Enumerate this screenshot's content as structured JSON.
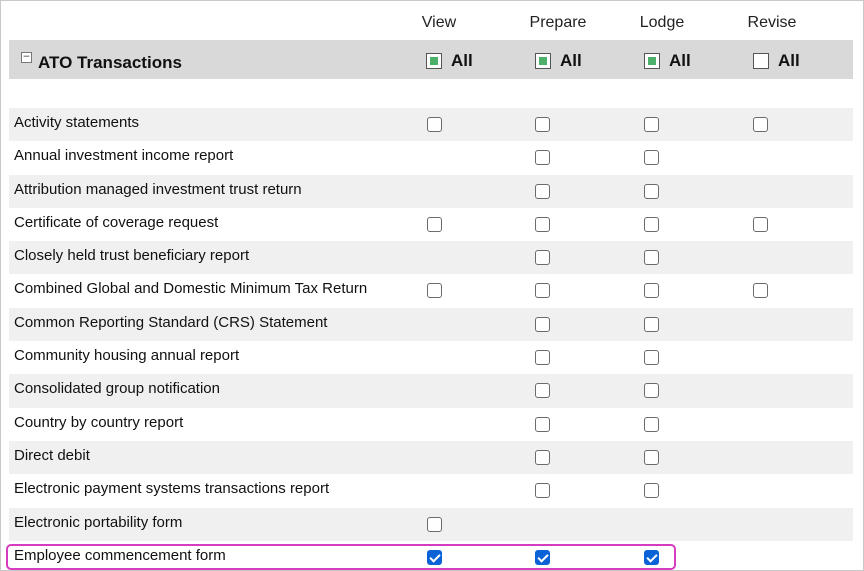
{
  "columns": {
    "view": "View",
    "prepare": "Prepare",
    "lodge": "Lodge",
    "revise": "Revise"
  },
  "section": {
    "collapse_symbol": "−",
    "title": "ATO Transactions",
    "all_label": "All",
    "all_state": {
      "view": "partial",
      "prepare": "partial",
      "lodge": "partial",
      "revise": "unchecked"
    }
  },
  "rows": [
    {
      "label": "Activity statements",
      "view": false,
      "prepare": false,
      "lodge": false,
      "revise": false
    },
    {
      "label": "Annual investment income report",
      "view": null,
      "prepare": false,
      "lodge": false,
      "revise": null
    },
    {
      "label": "Attribution managed investment trust return",
      "view": null,
      "prepare": false,
      "lodge": false,
      "revise": null
    },
    {
      "label": "Certificate of coverage request",
      "view": false,
      "prepare": false,
      "lodge": false,
      "revise": false
    },
    {
      "label": "Closely held trust beneficiary report",
      "view": null,
      "prepare": false,
      "lodge": false,
      "revise": null
    },
    {
      "label": "Combined Global and Domestic Minimum Tax Return",
      "view": false,
      "prepare": false,
      "lodge": false,
      "revise": false
    },
    {
      "label": "Common Reporting Standard (CRS) Statement",
      "view": null,
      "prepare": false,
      "lodge": false,
      "revise": null
    },
    {
      "label": "Community housing annual report",
      "view": null,
      "prepare": false,
      "lodge": false,
      "revise": null
    },
    {
      "label": "Consolidated group notification",
      "view": null,
      "prepare": false,
      "lodge": false,
      "revise": null
    },
    {
      "label": "Country by country report",
      "view": null,
      "prepare": false,
      "lodge": false,
      "revise": null
    },
    {
      "label": "Direct debit",
      "view": null,
      "prepare": false,
      "lodge": false,
      "revise": null
    },
    {
      "label": "Electronic payment systems transactions report",
      "view": null,
      "prepare": false,
      "lodge": false,
      "revise": null
    },
    {
      "label": "Electronic portability form",
      "view": false,
      "prepare": null,
      "lodge": null,
      "revise": null
    },
    {
      "label": "Employee commencement form",
      "view": true,
      "prepare": true,
      "lodge": true,
      "revise": null,
      "highlighted": true
    }
  ],
  "colors": {
    "highlight_border": "#d63cc0",
    "checked_fill": "#0b62d6",
    "partial_fill": "#4caf6a",
    "section_bar": "#d9d9d9"
  }
}
